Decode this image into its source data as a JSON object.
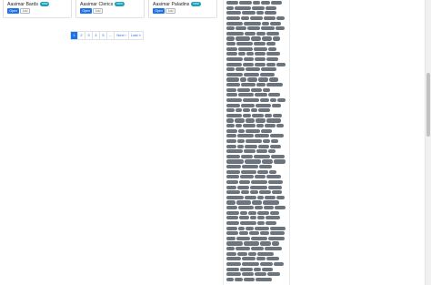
{
  "cards": [
    {
      "title": "Aasimar Bards",
      "badge": "new",
      "open_label": "Open",
      "add_label": "Add"
    },
    {
      "title": "Aasimar Clerics",
      "badge": "new",
      "open_label": "Open",
      "add_label": "Add"
    },
    {
      "title": "Aasimar Paladins",
      "badge": "new",
      "open_label": "Open",
      "add_label": "Add"
    }
  ],
  "pagination": {
    "items": [
      "1",
      "2",
      "3",
      "4",
      "5",
      "...",
      "Next ›",
      "Last »"
    ],
    "active": "1"
  },
  "colors": {
    "primary": "#1a73e8",
    "badge": "#17a2b8",
    "tag": "#6c757d"
  }
}
